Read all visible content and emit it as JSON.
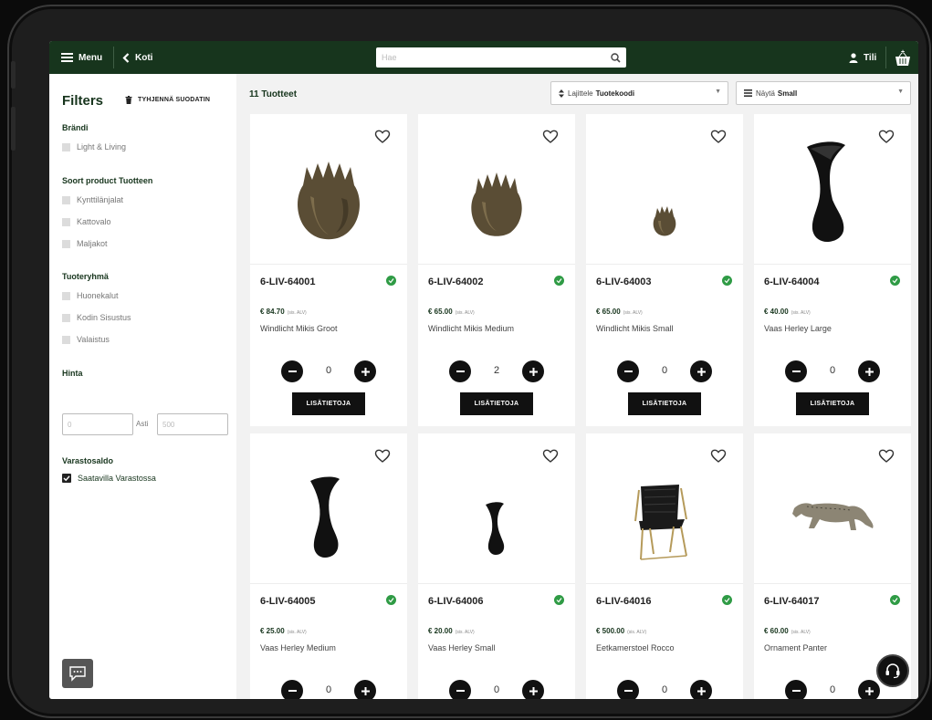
{
  "topbar": {
    "menu_label": "Menu",
    "back_label": "Koti",
    "search_placeholder": "Hae",
    "account_label": "Tili"
  },
  "filters": {
    "title": "Filters",
    "clear_label": "TYHJENNÄ SUODATIN",
    "brand": {
      "title": "Brändi",
      "options": [
        "Light & Living"
      ]
    },
    "product_type": {
      "title": "Soort product Tuotteen",
      "options": [
        "Kynttilänjalat",
        "Kattovalo",
        "Maljakot"
      ]
    },
    "product_group": {
      "title": "Tuoteryhmä",
      "options": [
        "Huonekalut",
        "Kodin Sisustus",
        "Valaistus"
      ]
    },
    "price": {
      "title": "Hinta",
      "min_placeholder": "0",
      "separator": "Asti",
      "max_placeholder": "500"
    },
    "stock": {
      "title": "Varastosaldo",
      "option": "Saatavilla Varastossa"
    }
  },
  "main": {
    "count_label": "11 Tuotteet",
    "sort": {
      "prefix": "Lajittele",
      "value": "Tuotekoodi"
    },
    "view": {
      "prefix": "Näytä",
      "value": "Small"
    }
  },
  "products": [
    {
      "code": "6-LIV-64001",
      "price": "€ 84.70",
      "vat": "(sis. ALV)",
      "name": "Windlicht Mikis Groot",
      "qty": "0",
      "button": "LISÄTIETOJA",
      "image": "tulip-vase"
    },
    {
      "code": "6-LIV-64002",
      "price": "€ 65.00",
      "vat": "(sis. ALV)",
      "name": "Windlicht Mikis Medium",
      "qty": "2",
      "button": "LISÄTIETOJA",
      "image": "tulip-vase"
    },
    {
      "code": "6-LIV-64003",
      "price": "€ 65.00",
      "vat": "(sis. ALV)",
      "name": "Windlicht Mikis Small",
      "qty": "0",
      "button": "LISÄTIETOJA",
      "image": "tulip-vase"
    },
    {
      "code": "6-LIV-64004",
      "price": "€ 40.00",
      "vat": "(sis. ALV)",
      "name": "Vaas Herley Large",
      "qty": "0",
      "button": "LISÄTIETOJA",
      "image": "black-vase"
    },
    {
      "code": "6-LIV-64005",
      "price": "€ 25.00",
      "vat": "(sis. ALV)",
      "name": "Vaas Herley Medium",
      "qty": "0",
      "image": "black-vase"
    },
    {
      "code": "6-LIV-64006",
      "price": "€ 20.00",
      "vat": "(sis. ALV)",
      "name": "Vaas Herley Small",
      "qty": "0",
      "image": "black-vase"
    },
    {
      "code": "6-LIV-64016",
      "price": "€ 500.00",
      "vat": "(sis. ALV)",
      "name": "Eetkamerstoel Rocco",
      "qty": "0",
      "image": "dining-chair"
    },
    {
      "code": "6-LIV-64017",
      "price": "€ 60.00",
      "vat": "(sis. ALV)",
      "name": "Ornament Panter",
      "qty": "0",
      "image": "panther-ornament"
    }
  ],
  "icons": {
    "menu": "hamburger-icon",
    "back": "chevron-left-icon",
    "search": "search-icon",
    "account": "user-icon",
    "cart": "basket-icon",
    "favorite": "heart-icon",
    "stock": "check-circle-icon",
    "chat": "chat-icon",
    "support": "headset-icon"
  },
  "colors": {
    "brand_green": "#17351d",
    "stock_green": "#2f9b45",
    "button_black": "#111111"
  }
}
